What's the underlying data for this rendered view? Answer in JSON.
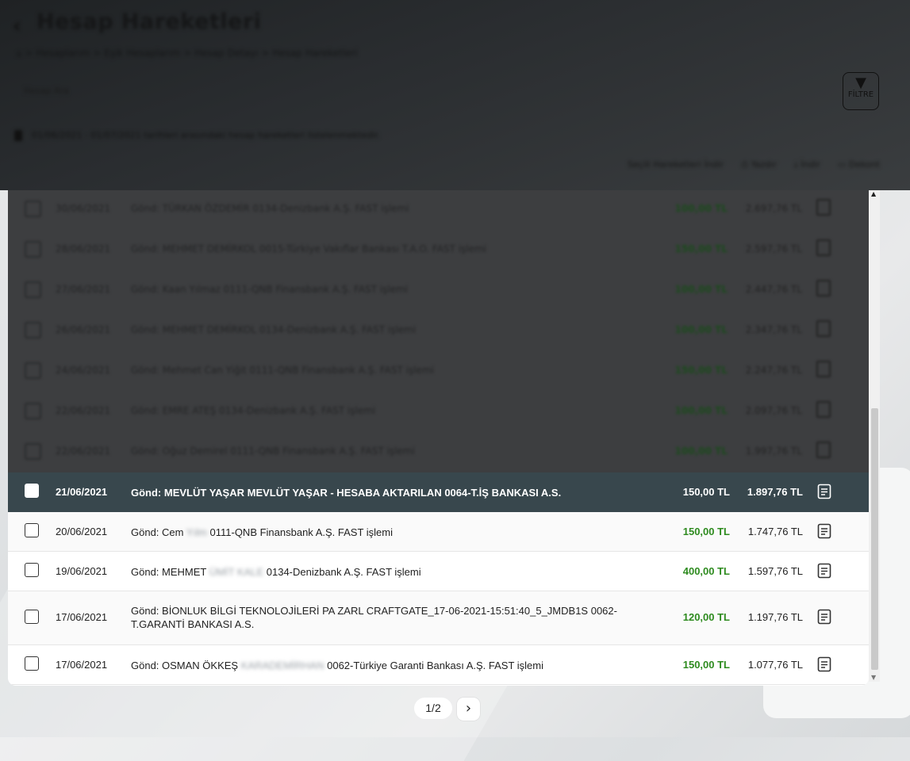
{
  "header": {
    "title": "Hesap Hareketleri",
    "breadcrumb": "⌂  >  Hesaplarım  >  Eşik Hesaplarım  >  Hesap Detayı  >  Hesap Hareketleri",
    "filter_label": "FİLTRE",
    "search_placeholder": "Hesap Ara",
    "info_text": "01/06/2021 - 01/07/2021 tarihleri arasındaki hesap hareketleri listelenmektedir.",
    "tools": [
      "Seçili Hareketleri İndir",
      "Yazdır",
      "İndir",
      "Dekont"
    ]
  },
  "blurred_rows": [
    {
      "date": "30/06/2021",
      "desc": "Gönd: TÜRKAN ÖZDEMİR 0134-Denizbank A.Ş. FAST işlemi",
      "amount": "100,00 TL",
      "balance": "2.697,76 TL"
    },
    {
      "date": "28/06/2021",
      "desc": "Gönd: MEHMET DEMİRKOL 0015-Türkiye Vakıflar Bankası T.A.O. FAST işlemi",
      "amount": "150,00 TL",
      "balance": "2.597,76 TL"
    },
    {
      "date": "27/06/2021",
      "desc": "Gönd: Kaan Yılmaz 0111-QNB Finansbank A.Ş. FAST işlemi",
      "amount": "100,00 TL",
      "balance": "2.447,76 TL"
    },
    {
      "date": "26/06/2021",
      "desc": "Gönd: MEHMET DEMİRKOL 0134-Denizbank A.Ş. FAST işlemi",
      "amount": "100,00 TL",
      "balance": "2.347,76 TL"
    },
    {
      "date": "24/06/2021",
      "desc": "Gönd: Mehmet Can Yiğit 0111-QNB Finansbank A.Ş. FAST işlemi",
      "amount": "150,00 TL",
      "balance": "2.247,76 TL"
    },
    {
      "date": "22/06/2021",
      "desc": "Gönd: EMRE ATEŞ 0134-Denizbank A.Ş. FAST işlemi",
      "amount": "100,00 TL",
      "balance": "2.097,76 TL"
    },
    {
      "date": "22/06/2021",
      "desc": "Gönd: Oğuz Demirel 0111-QNB Finansbank A.Ş. FAST işlemi",
      "amount": "100,00 TL",
      "balance": "1.997,76 TL"
    }
  ],
  "rows": [
    {
      "date": "21/06/2021",
      "desc_pre": "Gönd: MEVLÜT YAŞAR MEVLÜT YAŞAR - HESABA AKTARILAN 0064-T.İŞ BANKASI A.S.",
      "desc_blur": "",
      "desc_post": "",
      "amount": "150,00 TL",
      "balance": "1.897,76 TL"
    },
    {
      "date": "20/06/2021",
      "desc_pre": "Gönd: Cem",
      "desc_blur": "Yılm",
      "desc_post": "0111-QNB Finansbank A.Ş. FAST işlemi",
      "amount": "150,00 TL",
      "balance": "1.747,76 TL"
    },
    {
      "date": "19/06/2021",
      "desc_pre": "Gönd: MEHMET",
      "desc_blur": "ÜMİT KALE",
      "desc_post": "0134-Denizbank A.Ş. FAST işlemi",
      "amount": "400,00 TL",
      "balance": "1.597,76 TL"
    },
    {
      "date": "17/06/2021",
      "desc_pre": "Gönd: BİONLUK BİLGİ TEKNOLOJİLERİ PA ZARL CRAFTGATE_17-06-2021-15:51:40_5_JMDB1S 0062-T.GARANTİ BANKASI A.S.",
      "desc_blur": "",
      "desc_post": "",
      "amount": "120,00 TL",
      "balance": "1.197,76 TL"
    },
    {
      "date": "17/06/2021",
      "desc_pre": "Gönd: OSMAN ÖKKEŞ",
      "desc_blur": "KARADEMİRHAN",
      "desc_post": "0062-Türkiye Garanti Bankası A.Ş. FAST işlemi",
      "amount": "150,00 TL",
      "balance": "1.077,76 TL"
    }
  ],
  "pager": {
    "page": "1/2",
    "next": "›"
  },
  "colors": {
    "selected_row": "#38474d",
    "amount_green": "#2e8b1f"
  }
}
